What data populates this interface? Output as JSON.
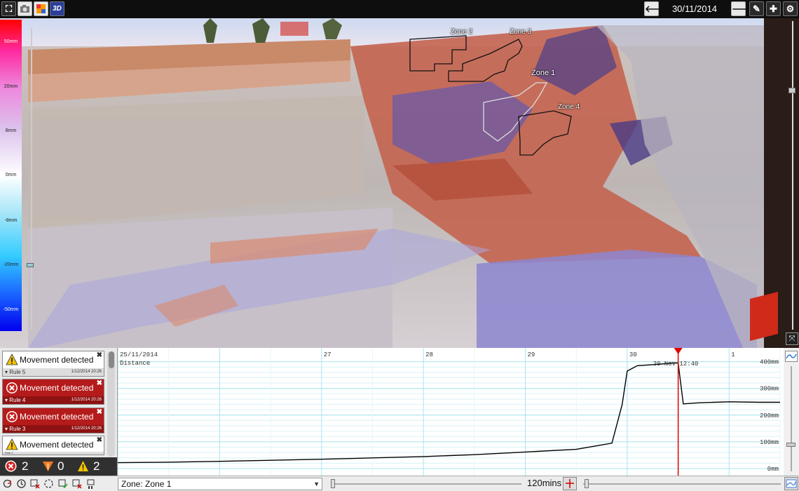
{
  "topbar": {
    "left_icons": [
      "expand-icon",
      "camera-icon",
      "color-palette-icon",
      "3d-view-icon"
    ],
    "datetime": "30/11/2014 12:40",
    "right_icons": [
      "arrow-left-icon",
      "arrow-right-icon",
      "pencil-icon",
      "plus-icon",
      "gear-icon"
    ],
    "label_3d": "3D"
  },
  "scale": {
    "labels": [
      "50mm",
      "20mm",
      "8mm",
      "0mm",
      "-8mm",
      "-20mm",
      "-50mm"
    ]
  },
  "zones": [
    {
      "label": "Zone 2"
    },
    {
      "label": "Zone 3"
    },
    {
      "label": "Zone 1"
    },
    {
      "label": "Zone 4"
    }
  ],
  "alerts": [
    {
      "title": "Movement detected",
      "rule": "Rule 5",
      "time": "1/12/2014 20:26",
      "severity": "warning"
    },
    {
      "title": "Movement detected",
      "rule": "Rule 4",
      "time": "1/12/2014 20:26",
      "severity": "alarm"
    },
    {
      "title": "Movement detected",
      "rule": "Rule 3",
      "time": "1/12/2014 20:26",
      "severity": "alarm"
    },
    {
      "title": "Movement detected",
      "rule": "Rule 2",
      "time": "",
      "severity": "warning"
    }
  ],
  "counts": {
    "alarm": "2",
    "caution": "0",
    "warning": "2"
  },
  "chart_data": {
    "type": "line",
    "title": "",
    "xlabel": "Distance",
    "ylabel": "",
    "x_tick_labels": [
      "25/11/2014",
      "27",
      "28",
      "29",
      "30",
      "1"
    ],
    "y_tick_labels": [
      "400mm",
      "300mm",
      "200mm",
      "100mm",
      "0mm"
    ],
    "ylim": [
      0,
      420
    ],
    "xlim_days": [
      25.0,
      31.5
    ],
    "cursor_label": "30-Nov 12:40",
    "cursor_x_day": 30.5,
    "series": [
      {
        "x_day": [
          25.0,
          25.5,
          26.0,
          26.5,
          27.0,
          27.5,
          28.0,
          28.5,
          29.0,
          29.5,
          29.85,
          29.95,
          30.0,
          30.1,
          30.3,
          30.45,
          30.5,
          30.55,
          30.7,
          31.0,
          31.3,
          31.5
        ],
        "y": [
          22,
          24,
          27,
          31,
          35,
          40,
          45,
          52,
          62,
          72,
          95,
          240,
          365,
          385,
          390,
          395,
          395,
          242,
          246,
          250,
          248,
          248
        ]
      }
    ]
  },
  "bottombar": {
    "zone_select": "Zone: Zone 1",
    "mins": "120mins"
  },
  "colors": {
    "alarm_red": "#b51b1b",
    "warning_yellow": "#f2c400",
    "cursor_red": "#e00000",
    "grid_cyan": "#a8e6f0"
  }
}
